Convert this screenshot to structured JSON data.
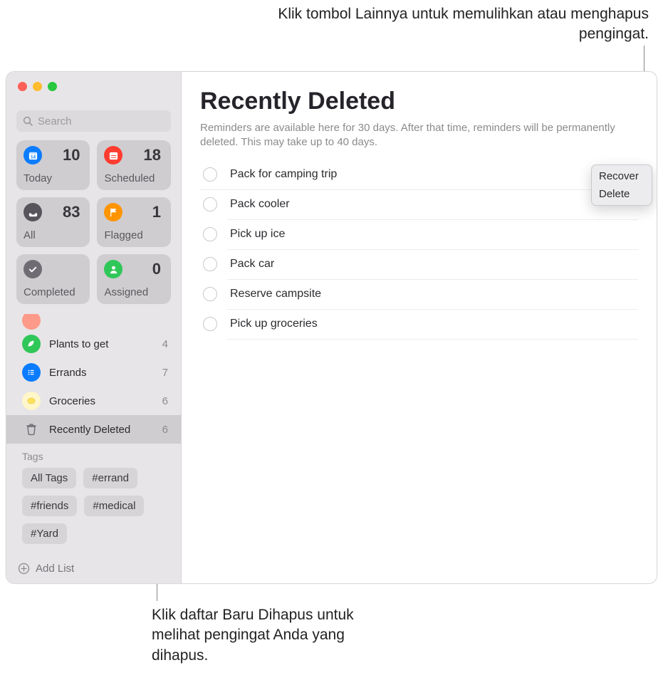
{
  "annotations": {
    "top": "Klik tombol Lainnya untuk memulihkan atau menghapus pengingat.",
    "bottom": "Klik daftar Baru Dihapus untuk melihat pengingat Anda yang dihapus."
  },
  "traffic_colors": {
    "close": "#fe5f57",
    "min": "#febc2e",
    "max": "#28c840"
  },
  "search": {
    "placeholder": "Search"
  },
  "smart": [
    {
      "key": "today",
      "label": "Today",
      "count": "10",
      "bg": "#0a7cff",
      "icon": "calendar"
    },
    {
      "key": "scheduled",
      "label": "Scheduled",
      "count": "18",
      "bg": "#fe3c30",
      "icon": "calendar-lines"
    },
    {
      "key": "all",
      "label": "All",
      "count": "83",
      "bg": "#57555b",
      "icon": "tray"
    },
    {
      "key": "flagged",
      "label": "Flagged",
      "count": "1",
      "bg": "#fe9500",
      "icon": "flag"
    },
    {
      "key": "completed",
      "label": "Completed",
      "count": "",
      "bg": "#6f6d73",
      "icon": "check"
    },
    {
      "key": "assigned",
      "label": "Assigned",
      "count": "0",
      "bg": "#30c759",
      "icon": "person"
    }
  ],
  "lists": [
    {
      "key": "plants",
      "label": "Plants to get",
      "count": "4",
      "color": "#30c759",
      "icon": "leaf"
    },
    {
      "key": "errands",
      "label": "Errands",
      "count": "7",
      "color": "#0a7cff",
      "icon": "list"
    },
    {
      "key": "grocery",
      "label": "Groceries",
      "count": "6",
      "color": "#ffe15a",
      "icon": "lemon"
    },
    {
      "key": "deleted",
      "label": "Recently Deleted",
      "count": "6",
      "color": "#8a888c",
      "icon": "trash",
      "selected": true
    }
  ],
  "tags": {
    "title": "Tags",
    "items": [
      "All Tags",
      "#errand",
      "#friends",
      "#medical",
      "#Yard"
    ]
  },
  "add_list_label": "Add List",
  "main": {
    "title": "Recently Deleted",
    "description": "Reminders are available here for 30 days. After that time, reminders will be permanently deleted. This may take up to 40 days.",
    "reminders": [
      "Pack for camping trip",
      "Pack cooler",
      "Pick up ice",
      "Pack car",
      "Reserve campsite",
      "Pick up groceries"
    ]
  },
  "popover": {
    "recover": "Recover",
    "delete": "Delete"
  }
}
